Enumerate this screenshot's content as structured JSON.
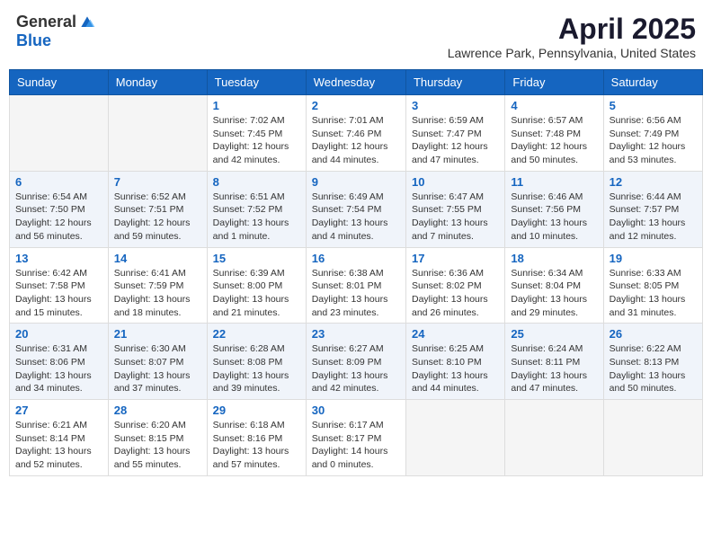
{
  "header": {
    "logo_general": "General",
    "logo_blue": "Blue",
    "month_title": "April 2025",
    "location": "Lawrence Park, Pennsylvania, United States"
  },
  "weekdays": [
    "Sunday",
    "Monday",
    "Tuesday",
    "Wednesday",
    "Thursday",
    "Friday",
    "Saturday"
  ],
  "weeks": [
    [
      {
        "day": "",
        "sunrise": "",
        "sunset": "",
        "daylight": ""
      },
      {
        "day": "",
        "sunrise": "",
        "sunset": "",
        "daylight": ""
      },
      {
        "day": "1",
        "sunrise": "Sunrise: 7:02 AM",
        "sunset": "Sunset: 7:45 PM",
        "daylight": "Daylight: 12 hours and 42 minutes."
      },
      {
        "day": "2",
        "sunrise": "Sunrise: 7:01 AM",
        "sunset": "Sunset: 7:46 PM",
        "daylight": "Daylight: 12 hours and 44 minutes."
      },
      {
        "day": "3",
        "sunrise": "Sunrise: 6:59 AM",
        "sunset": "Sunset: 7:47 PM",
        "daylight": "Daylight: 12 hours and 47 minutes."
      },
      {
        "day": "4",
        "sunrise": "Sunrise: 6:57 AM",
        "sunset": "Sunset: 7:48 PM",
        "daylight": "Daylight: 12 hours and 50 minutes."
      },
      {
        "day": "5",
        "sunrise": "Sunrise: 6:56 AM",
        "sunset": "Sunset: 7:49 PM",
        "daylight": "Daylight: 12 hours and 53 minutes."
      }
    ],
    [
      {
        "day": "6",
        "sunrise": "Sunrise: 6:54 AM",
        "sunset": "Sunset: 7:50 PM",
        "daylight": "Daylight: 12 hours and 56 minutes."
      },
      {
        "day": "7",
        "sunrise": "Sunrise: 6:52 AM",
        "sunset": "Sunset: 7:51 PM",
        "daylight": "Daylight: 12 hours and 59 minutes."
      },
      {
        "day": "8",
        "sunrise": "Sunrise: 6:51 AM",
        "sunset": "Sunset: 7:52 PM",
        "daylight": "Daylight: 13 hours and 1 minute."
      },
      {
        "day": "9",
        "sunrise": "Sunrise: 6:49 AM",
        "sunset": "Sunset: 7:54 PM",
        "daylight": "Daylight: 13 hours and 4 minutes."
      },
      {
        "day": "10",
        "sunrise": "Sunrise: 6:47 AM",
        "sunset": "Sunset: 7:55 PM",
        "daylight": "Daylight: 13 hours and 7 minutes."
      },
      {
        "day": "11",
        "sunrise": "Sunrise: 6:46 AM",
        "sunset": "Sunset: 7:56 PM",
        "daylight": "Daylight: 13 hours and 10 minutes."
      },
      {
        "day": "12",
        "sunrise": "Sunrise: 6:44 AM",
        "sunset": "Sunset: 7:57 PM",
        "daylight": "Daylight: 13 hours and 12 minutes."
      }
    ],
    [
      {
        "day": "13",
        "sunrise": "Sunrise: 6:42 AM",
        "sunset": "Sunset: 7:58 PM",
        "daylight": "Daylight: 13 hours and 15 minutes."
      },
      {
        "day": "14",
        "sunrise": "Sunrise: 6:41 AM",
        "sunset": "Sunset: 7:59 PM",
        "daylight": "Daylight: 13 hours and 18 minutes."
      },
      {
        "day": "15",
        "sunrise": "Sunrise: 6:39 AM",
        "sunset": "Sunset: 8:00 PM",
        "daylight": "Daylight: 13 hours and 21 minutes."
      },
      {
        "day": "16",
        "sunrise": "Sunrise: 6:38 AM",
        "sunset": "Sunset: 8:01 PM",
        "daylight": "Daylight: 13 hours and 23 minutes."
      },
      {
        "day": "17",
        "sunrise": "Sunrise: 6:36 AM",
        "sunset": "Sunset: 8:02 PM",
        "daylight": "Daylight: 13 hours and 26 minutes."
      },
      {
        "day": "18",
        "sunrise": "Sunrise: 6:34 AM",
        "sunset": "Sunset: 8:04 PM",
        "daylight": "Daylight: 13 hours and 29 minutes."
      },
      {
        "day": "19",
        "sunrise": "Sunrise: 6:33 AM",
        "sunset": "Sunset: 8:05 PM",
        "daylight": "Daylight: 13 hours and 31 minutes."
      }
    ],
    [
      {
        "day": "20",
        "sunrise": "Sunrise: 6:31 AM",
        "sunset": "Sunset: 8:06 PM",
        "daylight": "Daylight: 13 hours and 34 minutes."
      },
      {
        "day": "21",
        "sunrise": "Sunrise: 6:30 AM",
        "sunset": "Sunset: 8:07 PM",
        "daylight": "Daylight: 13 hours and 37 minutes."
      },
      {
        "day": "22",
        "sunrise": "Sunrise: 6:28 AM",
        "sunset": "Sunset: 8:08 PM",
        "daylight": "Daylight: 13 hours and 39 minutes."
      },
      {
        "day": "23",
        "sunrise": "Sunrise: 6:27 AM",
        "sunset": "Sunset: 8:09 PM",
        "daylight": "Daylight: 13 hours and 42 minutes."
      },
      {
        "day": "24",
        "sunrise": "Sunrise: 6:25 AM",
        "sunset": "Sunset: 8:10 PM",
        "daylight": "Daylight: 13 hours and 44 minutes."
      },
      {
        "day": "25",
        "sunrise": "Sunrise: 6:24 AM",
        "sunset": "Sunset: 8:11 PM",
        "daylight": "Daylight: 13 hours and 47 minutes."
      },
      {
        "day": "26",
        "sunrise": "Sunrise: 6:22 AM",
        "sunset": "Sunset: 8:13 PM",
        "daylight": "Daylight: 13 hours and 50 minutes."
      }
    ],
    [
      {
        "day": "27",
        "sunrise": "Sunrise: 6:21 AM",
        "sunset": "Sunset: 8:14 PM",
        "daylight": "Daylight: 13 hours and 52 minutes."
      },
      {
        "day": "28",
        "sunrise": "Sunrise: 6:20 AM",
        "sunset": "Sunset: 8:15 PM",
        "daylight": "Daylight: 13 hours and 55 minutes."
      },
      {
        "day": "29",
        "sunrise": "Sunrise: 6:18 AM",
        "sunset": "Sunset: 8:16 PM",
        "daylight": "Daylight: 13 hours and 57 minutes."
      },
      {
        "day": "30",
        "sunrise": "Sunrise: 6:17 AM",
        "sunset": "Sunset: 8:17 PM",
        "daylight": "Daylight: 14 hours and 0 minutes."
      },
      {
        "day": "",
        "sunrise": "",
        "sunset": "",
        "daylight": ""
      },
      {
        "day": "",
        "sunrise": "",
        "sunset": "",
        "daylight": ""
      },
      {
        "day": "",
        "sunrise": "",
        "sunset": "",
        "daylight": ""
      }
    ]
  ]
}
